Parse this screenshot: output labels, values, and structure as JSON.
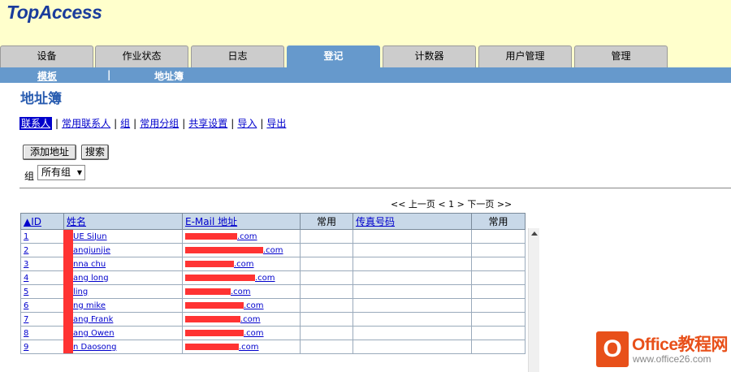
{
  "app": {
    "logo": "TopAccess"
  },
  "tabs": [
    {
      "label": "设备"
    },
    {
      "label": "作业状态"
    },
    {
      "label": "日志"
    },
    {
      "label": "登记",
      "active": true
    },
    {
      "label": "计数器"
    },
    {
      "label": "用户管理"
    },
    {
      "label": "管理"
    }
  ],
  "subnav": {
    "template": "模板",
    "sep": "|",
    "address_book": "地址簿"
  },
  "page": {
    "title": "地址簿"
  },
  "links": [
    {
      "label": "联系人",
      "selected": true
    },
    {
      "label": "常用联系人"
    },
    {
      "label": "组"
    },
    {
      "label": "常用分组"
    },
    {
      "label": "共享设置"
    },
    {
      "label": "导入"
    },
    {
      "label": "导出"
    }
  ],
  "buttons": {
    "add_address": "添加地址",
    "search": "搜索"
  },
  "group": {
    "label": "组",
    "selected": "所有组"
  },
  "pager": {
    "text": "<< 上一页 < 1 > 下一页 >>"
  },
  "table": {
    "headers": {
      "id": "▲ID",
      "name": "姓名",
      "email": "E-Mail 地址",
      "common1": "常用",
      "fax": "传真号码",
      "common2": "常用"
    },
    "rows": [
      {
        "id": "1",
        "name": "UE SiJun",
        "email": ".com"
      },
      {
        "id": "2",
        "name": "angjunjie",
        "email": ".com"
      },
      {
        "id": "3",
        "name": "nna chu",
        "email": ".com"
      },
      {
        "id": "4",
        "name": "ang long",
        "email": ".com"
      },
      {
        "id": "5",
        "name": "ling",
        "email": ".com"
      },
      {
        "id": "6",
        "name": "ng mike",
        "email": ".com"
      },
      {
        "id": "7",
        "name": "ang Frank",
        "email": ".com"
      },
      {
        "id": "8",
        "name": "ang Owen",
        "email": ".com"
      },
      {
        "id": "9",
        "name": "n Daosong",
        "email": ".com"
      }
    ]
  },
  "watermark": {
    "icon": "O",
    "line1": "Office教程网",
    "line2": "www.office26.com"
  },
  "colors": {
    "header_bg": "#ffffcc",
    "tab_bg": "#cccccc",
    "active_tab": "#6699cc",
    "link": "#0000cc",
    "redaction": "#ff3333",
    "watermark": "#e8501a"
  }
}
